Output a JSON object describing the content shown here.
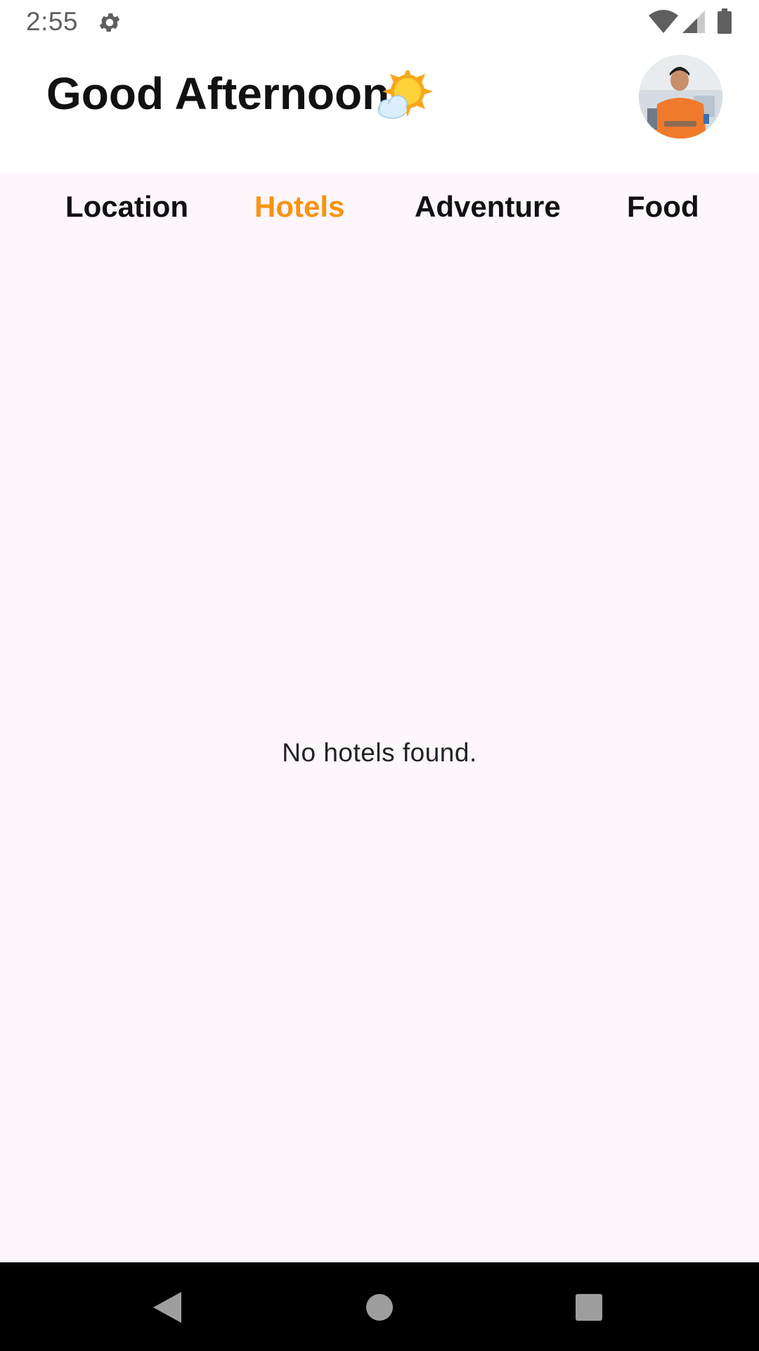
{
  "status_bar": {
    "time": "2:55",
    "icons": [
      "gear-icon",
      "wifi-icon",
      "cell-signal-icon",
      "battery-icon"
    ]
  },
  "header": {
    "greeting": "Good Afternoon",
    "weather_icon": "sun-behind-cloud-icon",
    "avatar": "user-avatar"
  },
  "tabs": [
    {
      "label": "Location",
      "active": false
    },
    {
      "label": "Hotels",
      "active": true
    },
    {
      "label": "Adventure",
      "active": false
    },
    {
      "label": "Food",
      "active": false
    }
  ],
  "content": {
    "empty_message": "No hotels found."
  },
  "nav_bar": {
    "icons": [
      "back-icon",
      "home-icon",
      "recents-icon"
    ]
  },
  "colors": {
    "accent": "#f8940f",
    "background": "#fdf6fd",
    "header_background": "#ffffff",
    "text": "#111111",
    "nav_bar": "#000000"
  }
}
